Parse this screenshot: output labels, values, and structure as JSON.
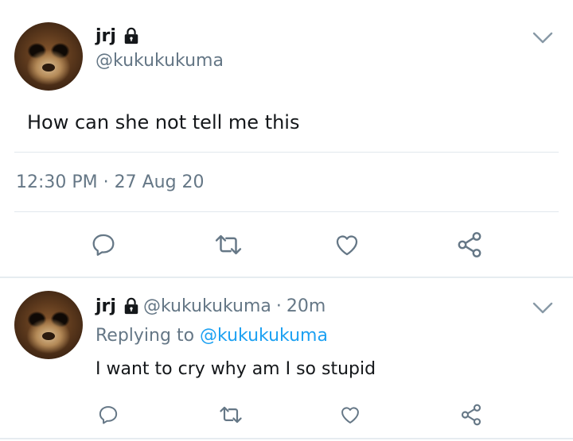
{
  "main_tweet": {
    "display_name": "jrj",
    "handle": "@kukukukuma",
    "text": "How can she not tell me this",
    "timestamp": "12:30 PM · 27 Aug 20",
    "avatar_icon": "bear-cub-avatar",
    "protected_icon": "lock-icon"
  },
  "reply_tweet": {
    "display_name": "jrj",
    "handle": "@kukukukuma",
    "separator": "·",
    "time_ago": "20m",
    "replying_prefix": "Replying to",
    "replying_to": "@kukukukuma",
    "text": "I want to cry why am I so stupid",
    "avatar_icon": "bear-cub-avatar",
    "protected_icon": "lock-icon"
  },
  "actions": [
    "reply-icon",
    "retweet-icon",
    "like-icon",
    "share-icon"
  ],
  "colors": {
    "text": "#14171a",
    "secondary": "#657786",
    "link": "#1da1f2",
    "divider": "#e1e8ed",
    "icon": "#657786"
  }
}
